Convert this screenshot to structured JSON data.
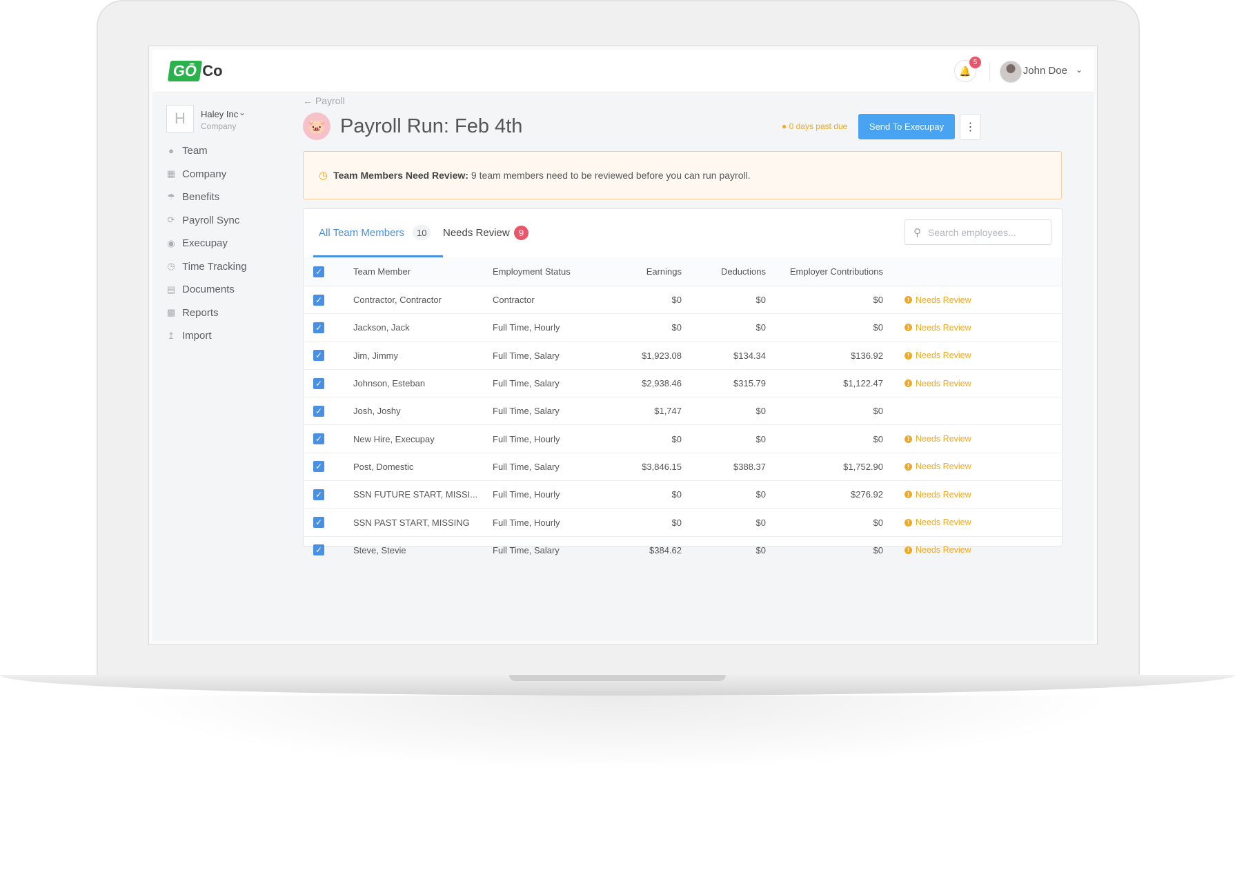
{
  "header": {
    "logo_go": "GŌ",
    "logo_co": "Co",
    "notification_count": "5",
    "user_name": "John Doe"
  },
  "sidebar": {
    "company_initial": "H",
    "company_name": "Haley Inc",
    "company_sub": "Company",
    "items": [
      {
        "label": "Team",
        "icon": "users-icon"
      },
      {
        "label": "Company",
        "icon": "building-icon"
      },
      {
        "label": "Benefits",
        "icon": "umbrella-icon"
      },
      {
        "label": "Payroll Sync",
        "icon": "sync-icon"
      },
      {
        "label": "Execupay",
        "icon": "piggy-bank-icon"
      },
      {
        "label": "Time Tracking",
        "icon": "clock-icon"
      },
      {
        "label": "Documents",
        "icon": "document-icon"
      },
      {
        "label": "Reports",
        "icon": "bar-chart-icon"
      },
      {
        "label": "Import",
        "icon": "upload-icon"
      }
    ]
  },
  "main": {
    "back_label": "Payroll",
    "title": "Payroll Run: Feb 4th",
    "due_text": "0 days past due",
    "send_button": "Send To Execupay",
    "alert_title": "Team Members Need Review:",
    "alert_text": "9 team members need to be reviewed before you can run payroll.",
    "tabs": {
      "all_label": "All Team Members",
      "all_count": "10",
      "review_label": "Needs Review",
      "review_count": "9"
    },
    "search_placeholder": "Search employees...",
    "columns": [
      "Team Member",
      "Employment Status",
      "Earnings",
      "Deductions",
      "Employer Contributions"
    ],
    "review_label": "Needs Review",
    "rows": [
      {
        "name": "Contractor, Contractor",
        "status": "Contractor",
        "earnings": "$0",
        "deductions": "$0",
        "contributions": "$0",
        "needs_review": true
      },
      {
        "name": "Jackson, Jack",
        "status": "Full Time, Hourly",
        "earnings": "$0",
        "deductions": "$0",
        "contributions": "$0",
        "needs_review": true
      },
      {
        "name": "Jim, Jimmy",
        "status": "Full Time, Salary",
        "earnings": "$1,923.08",
        "deductions": "$134.34",
        "contributions": "$136.92",
        "needs_review": true
      },
      {
        "name": "Johnson, Esteban",
        "status": "Full Time, Salary",
        "earnings": "$2,938.46",
        "deductions": "$315.79",
        "contributions": "$1,122.47",
        "needs_review": true
      },
      {
        "name": "Josh, Joshy",
        "status": "Full Time, Salary",
        "earnings": "$1,747",
        "deductions": "$0",
        "contributions": "$0",
        "needs_review": false
      },
      {
        "name": "New Hire, Execupay",
        "status": "Full Time, Hourly",
        "earnings": "$0",
        "deductions": "$0",
        "contributions": "$0",
        "needs_review": true
      },
      {
        "name": "Post, Domestic",
        "status": "Full Time, Salary",
        "earnings": "$3,846.15",
        "deductions": "$388.37",
        "contributions": "$1,752.90",
        "needs_review": true
      },
      {
        "name": "SSN FUTURE START, MISSI...",
        "status": "Full Time, Hourly",
        "earnings": "$0",
        "deductions": "$0",
        "contributions": "$276.92",
        "needs_review": true
      },
      {
        "name": "SSN PAST START, MISSING",
        "status": "Full Time, Hourly",
        "earnings": "$0",
        "deductions": "$0",
        "contributions": "$0",
        "needs_review": true
      },
      {
        "name": "Steve, Stevie",
        "status": "Full Time, Salary",
        "earnings": "$384.62",
        "deductions": "$0",
        "contributions": "$0",
        "needs_review": true
      }
    ]
  },
  "colors": {
    "accent": "#4a90e2",
    "brand_green": "#2bb24c",
    "warning": "#f0a922",
    "badge_red": "#e8566b"
  }
}
